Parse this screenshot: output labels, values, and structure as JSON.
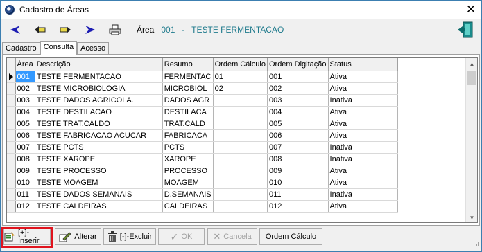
{
  "window": {
    "title": "Cadastro de Áreas",
    "close_glyph": "✕"
  },
  "toolbar": {
    "area_label": "Área",
    "area_value": "001   -   TESTE FERMENTACAO",
    "buttons": [
      "first-icon",
      "previous-icon",
      "next-icon",
      "last-icon",
      "print-icon"
    ],
    "exit_icon": "exit-door-icon"
  },
  "tabs": [
    "Cadastro",
    "Consulta",
    "Acesso"
  ],
  "grid": {
    "columns": [
      "Área",
      "Descrição",
      "Resumo",
      "Ordem Cálculo",
      "Ordem Digitação",
      "Status"
    ],
    "rows": [
      [
        "001",
        "TESTE FERMENTACAO",
        "FERMENTAC",
        "01",
        "001",
        "Ativa"
      ],
      [
        "002",
        "TESTE MICROBIOLOGIA",
        "MICROBIOL",
        "02",
        "002",
        "Ativa"
      ],
      [
        "003",
        "TESTE DADOS AGRICOLA.",
        "DADOS AGR",
        "",
        "003",
        "Inativa"
      ],
      [
        "004",
        "TESTE DESTILACAO",
        "DESTILACA",
        "",
        "004",
        "Ativa"
      ],
      [
        "005",
        "TESTE TRAT.CALDO",
        "TRAT.CALD",
        "",
        "005",
        "Ativa"
      ],
      [
        "006",
        "TESTE FABRICACAO ACUCAR",
        "FABRICACA",
        "",
        "006",
        "Ativa"
      ],
      [
        "007",
        "TESTE PCTS",
        "PCTS",
        "",
        "007",
        "Inativa"
      ],
      [
        "008",
        "TESTE XAROPE",
        "XAROPE",
        "",
        "008",
        "Inativa"
      ],
      [
        "009",
        "TESTE PROCESSO",
        "PROCESSO",
        "",
        "009",
        "Ativa"
      ],
      [
        "010",
        "TESTE MOAGEM",
        "MOAGEM",
        "",
        "010",
        "Ativa"
      ],
      [
        "011",
        "TESTE DADOS SEMANAIS",
        "D.SEMANAIS",
        "",
        "011",
        "Inativa"
      ],
      [
        "012",
        "TESTE CALDEIRAS",
        "CALDEIRAS",
        "",
        "012",
        "Ativa"
      ]
    ]
  },
  "buttons": {
    "inserir": "[+]-Inserir",
    "alterar": "Alterar",
    "excluir": "[-]-Excluir",
    "ok": "OK",
    "cancela": "Cancela",
    "ordem_calculo": "Ordem Cálculo"
  },
  "colors": {
    "accent_value": "#1e7a8c",
    "selection": "#3399ff",
    "highlight_box": "#e0141e"
  }
}
